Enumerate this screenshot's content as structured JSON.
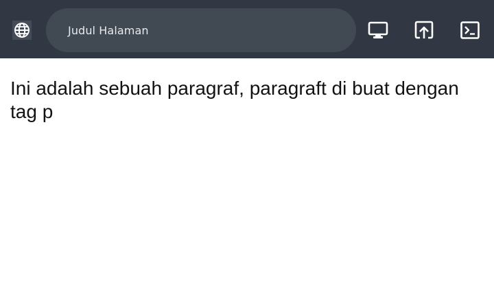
{
  "header": {
    "page_title": "Judul Halaman",
    "icons": {
      "site": "globe-icon",
      "desktop": "desktop-icon",
      "open_in_new": "open-in-new-icon",
      "terminal": "terminal-icon"
    },
    "colors": {
      "bar": "#313843",
      "pill": "#414953",
      "icon": "#ffffff"
    }
  },
  "main": {
    "paragraph": "Ini adalah sebuah paragraf, paragraft di buat dengan tag p"
  }
}
